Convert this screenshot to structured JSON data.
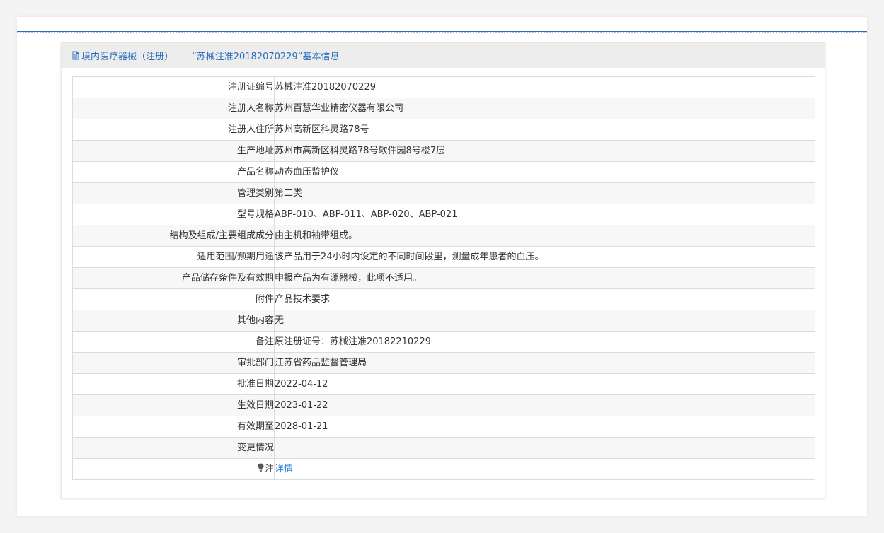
{
  "header": {
    "title": "境内医疗器械（注册）——“苏械注准20182070229”基本信息",
    "icon": "document-icon"
  },
  "rows": [
    {
      "label": "注册证编号",
      "value": "苏械注准20182070229"
    },
    {
      "label": "注册人名称",
      "value": "苏州百慧华业精密仪器有限公司"
    },
    {
      "label": "注册人住所",
      "value": "苏州高新区科灵路78号"
    },
    {
      "label": "生产地址",
      "value": "苏州市高新区科灵路78号软件园8号楼7层"
    },
    {
      "label": "产品名称",
      "value": "动态血压监护仪"
    },
    {
      "label": "管理类别",
      "value": "第二类"
    },
    {
      "label": "型号规格",
      "value": "ABP-010、ABP-011、ABP-020、ABP-021"
    },
    {
      "label": "结构及组成/主要组成成分",
      "value": "由主机和袖带组成。"
    },
    {
      "label": "适用范围/预期用途",
      "value": "该产品用于24小时内设定的不同时间段里，测量成年患者的血压。"
    },
    {
      "label": "产品储存条件及有效期",
      "value": "申报产品为有源器械，此项不适用。"
    },
    {
      "label": "附件",
      "value": "产品技术要求"
    },
    {
      "label": "其他内容",
      "value": "无"
    },
    {
      "label": "备注",
      "value": "原注册证号：苏械注准20182210229"
    },
    {
      "label": "审批部门",
      "value": "江苏省药品监督管理局"
    },
    {
      "label": "批准日期",
      "value": "2022-04-12"
    },
    {
      "label": "生效日期",
      "value": "2023-01-22"
    },
    {
      "label": "有效期至",
      "value": "2028-01-21"
    },
    {
      "label": "变更情况",
      "value": ""
    }
  ],
  "note": {
    "label": "注",
    "icon": "lightbulb-icon",
    "link_text": "详情"
  },
  "colors": {
    "accent": "#2a6ebb",
    "link": "#2a7fd4",
    "header_bg": "#ededed"
  }
}
